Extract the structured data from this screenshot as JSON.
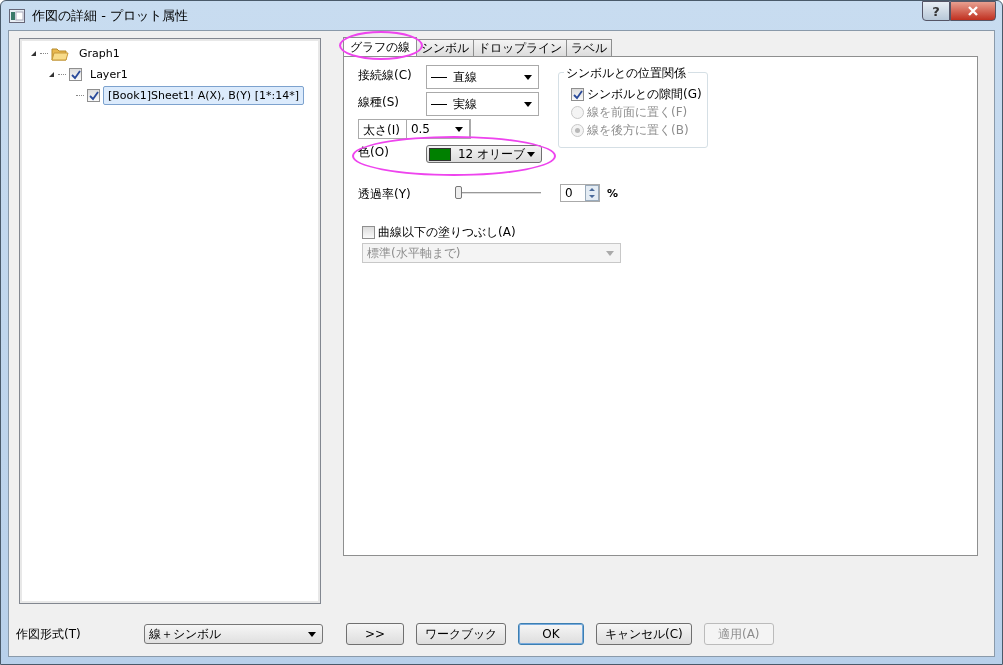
{
  "window": {
    "title": "作図の詳細 - プロット属性",
    "help": "?"
  },
  "tree": [
    {
      "label": "Graph1",
      "kind": "folder",
      "expanded": true,
      "children": [
        {
          "label": "Layer1",
          "checked": true,
          "expanded": true,
          "children": [
            {
              "label": "[Book1]Sheet1! A(X), B(Y) [1*:14*]",
              "checked": true,
              "selected": true
            }
          ]
        }
      ]
    }
  ],
  "tabs": [
    {
      "label": "グラフの線",
      "selected": true,
      "highlighted": true
    },
    {
      "label": "シンボル",
      "selected": false,
      "highlighted": false
    },
    {
      "label": "ドロップライン",
      "selected": false,
      "highlighted": false
    },
    {
      "label": "ラベル",
      "selected": false,
      "highlighted": false
    }
  ],
  "fields": [
    {
      "label": "接続線(C)",
      "value": "直線",
      "kind": "line-combo",
      "highlighted": false
    },
    {
      "label": "線種(S)",
      "value": "実線",
      "kind": "line-combo",
      "highlighted": false
    },
    {
      "label": "太さ(I)",
      "value": "0.5",
      "kind": "combo",
      "highlighted": false
    },
    {
      "label": "色(O)",
      "value": "12 オリーブ",
      "kind": "color",
      "color": "#008000",
      "highlighted": true
    }
  ],
  "symbol_group": {
    "title": "シンボルとの位置関係",
    "options": [
      {
        "kind": "checkbox",
        "label": "シンボルとの隙間(G)",
        "checked": true,
        "disabled": false
      },
      {
        "kind": "radio",
        "label": "線を前面に置く(F)",
        "selected": false,
        "disabled": true
      },
      {
        "kind": "radio",
        "label": "線を後方に置く(B)",
        "selected": true,
        "disabled": true
      }
    ]
  },
  "transparency": {
    "label": "透過率(Y)",
    "level": 0,
    "value": "0",
    "unit": "%"
  },
  "fill": {
    "label": "曲線以下の塗りつぶし(A)",
    "checked": false,
    "dropdown": "標準(水平軸まで)",
    "disabled": true
  },
  "plot_type": {
    "label": "作図形式(T)",
    "value": "線＋シンボル"
  },
  "buttons": [
    {
      "label": ">>",
      "default": false,
      "disabled": false
    },
    {
      "label": "ワークブック",
      "default": false,
      "disabled": false
    },
    {
      "label": "OK",
      "default": true,
      "disabled": false
    },
    {
      "label": "キャンセル(C)",
      "default": false,
      "disabled": false
    },
    {
      "label": "適用(A)",
      "default": false,
      "disabled": true
    }
  ]
}
